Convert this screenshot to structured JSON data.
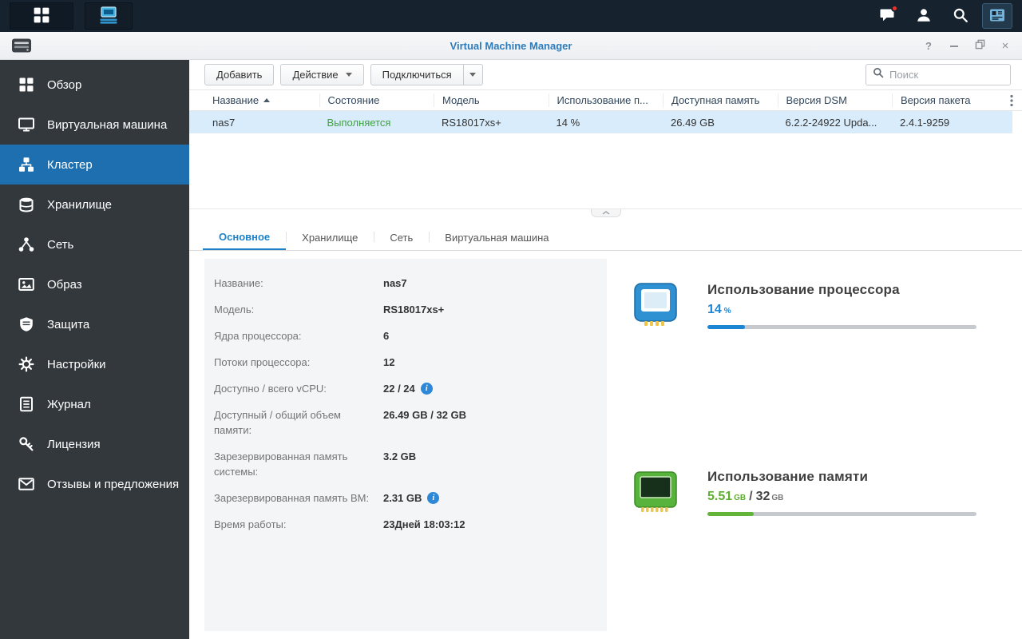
{
  "taskbar": {
    "apps": [
      {
        "name": "main-menu",
        "active": false
      },
      {
        "name": "virtual-machine-manager",
        "active": true
      }
    ],
    "status_icons": [
      {
        "name": "notifications",
        "badge": true
      },
      {
        "name": "user"
      },
      {
        "name": "search"
      },
      {
        "name": "pilot-view"
      }
    ]
  },
  "window": {
    "title": "Virtual Machine Manager",
    "controls": {
      "help": "?",
      "close": "×"
    }
  },
  "sidebar": {
    "items": [
      {
        "label": "Обзор",
        "icon": "overview-icon",
        "active": false
      },
      {
        "label": "Виртуальная машина",
        "icon": "virtual-machine-icon",
        "active": false
      },
      {
        "label": "Кластер",
        "icon": "cluster-icon",
        "active": true
      },
      {
        "label": "Хранилище",
        "icon": "storage-icon",
        "active": false
      },
      {
        "label": "Сеть",
        "icon": "network-icon",
        "active": false
      },
      {
        "label": "Образ",
        "icon": "image-icon",
        "active": false
      },
      {
        "label": "Защита",
        "icon": "protection-icon",
        "active": false
      },
      {
        "label": "Настройки",
        "icon": "settings-icon",
        "active": false
      },
      {
        "label": "Журнал",
        "icon": "log-icon",
        "active": false
      },
      {
        "label": "Лицензия",
        "icon": "license-icon",
        "active": false
      },
      {
        "label": "Отзывы и предложения",
        "icon": "feedback-icon",
        "active": false
      }
    ]
  },
  "toolbar": {
    "add_label": "Добавить",
    "action_label": "Действие",
    "connect_label": "Подключиться",
    "search_placeholder": "Поиск"
  },
  "table": {
    "columns": [
      {
        "label": "Название",
        "sort": "asc"
      },
      {
        "label": "Состояние"
      },
      {
        "label": "Модель"
      },
      {
        "label": "Использование п..."
      },
      {
        "label": "Доступная память"
      },
      {
        "label": "Версия DSM"
      },
      {
        "label": "Версия пакета"
      }
    ],
    "rows": [
      {
        "name": "nas7",
        "state": "Выполняется",
        "model": "RS18017xs+",
        "cpu_usage": "14 %",
        "available_memory": "26.49 GB",
        "dsm_version": "6.2.2-24922 Upda...",
        "package_version": "2.4.1-9259",
        "selected": true
      }
    ]
  },
  "tabs": [
    {
      "label": "Основное",
      "active": true
    },
    {
      "label": "Хранилище",
      "active": false
    },
    {
      "label": "Сеть",
      "active": false
    },
    {
      "label": "Виртуальная машина",
      "active": false
    }
  ],
  "details": {
    "fields": [
      {
        "label": "Название:",
        "value": "nas7"
      },
      {
        "label": "Модель:",
        "value": "RS18017xs+"
      },
      {
        "label": "Ядра процессора:",
        "value": "6"
      },
      {
        "label": "Потоки процессора:",
        "value": "12"
      },
      {
        "label": "Доступно / всего vCPU:",
        "value": "22 / 24",
        "info": true
      },
      {
        "label": "Доступный / общий объем памяти:",
        "value": "26.49 GB / 32 GB"
      },
      {
        "label": "Зарезервированная память системы:",
        "value": "3.2 GB"
      },
      {
        "label": "Зарезервированная память ВМ:",
        "value": "2.31 GB",
        "info": true
      },
      {
        "label": "Время работы:",
        "value": "23Дней 18:03:12"
      }
    ]
  },
  "usage": {
    "cpu": {
      "title": "Использование процессора",
      "value": "14",
      "unit": "%",
      "percent": 14
    },
    "memory": {
      "title": "Использование памяти",
      "used": "5.51",
      "used_unit": "GB",
      "separator": "/",
      "total": "32",
      "total_unit": "GB",
      "percent": 17.2
    }
  },
  "colors": {
    "accent_blue": "#1b86d4",
    "bar_green": "#63b53a",
    "status_green": "#3ea23e",
    "sidebar_active": "#1d6fb0",
    "selected_row": "#d9ecfb",
    "taskbar_bg": "#16222e",
    "sidebar_bg": "#33383d"
  }
}
